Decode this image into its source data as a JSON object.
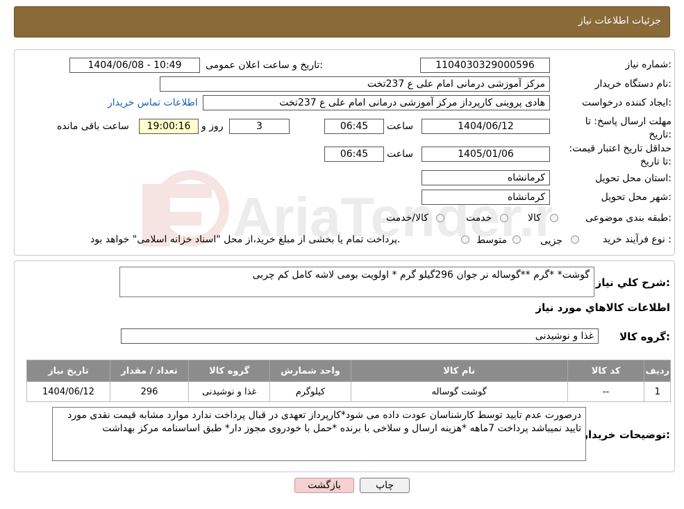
{
  "header": {
    "title": "جزئیات اطلاعات نیاز"
  },
  "watermark": {
    "brand": "AriaTender.neT"
  },
  "fields": {
    "need_number_label": "شماره نیاز:",
    "need_number": "1104030329000596",
    "announce_label": "تاریخ و ساعت اعلان عمومی:",
    "announce_value": "1404/06/08 - 10:49",
    "buyer_org_label": "نام دستگاه خریدار:",
    "buyer_org": "مرکز آموزشی درمانی امام علی ع 237تخت",
    "creator_label": "ایجاد کننده درخواست:",
    "creator": "هادی پروینی کارپرداز  مرکز آموزشی درمانی امام علی ع 237تخت",
    "contact_link": "اطلاعات تماس خریدار",
    "deadline_label": "مهلت ارسال پاسخ: تا تاریخ:",
    "deadline_date": "1404/06/12",
    "time_label": "ساعت",
    "deadline_time": "06:45",
    "days_count": "3",
    "days_label": "روز و",
    "remaining_time": "19:00:16",
    "remaining_label": "ساعت باقی مانده",
    "price_valid_label": "حداقل تاریخ اعتبار قیمت: تا تاریخ:",
    "price_valid_date": "1405/01/06",
    "price_valid_time": "06:45",
    "province_label": "استان محل تحویل:",
    "province": "کرمانشاه",
    "city_label": "شهر محل تحویل:",
    "city": "کرمانشاه",
    "category_label": "طبقه بندی موضوعی:",
    "category_options": [
      "کالا",
      "خدمت",
      "کالا/خدمت"
    ],
    "process_label": "نوع فرآیند خرید :",
    "process_options": [
      "جزیی",
      "متوسط"
    ],
    "process_note": "پرداخت تمام یا بخشی از مبلغ خرید،از محل \"اسناد خزانه اسلامی\" خواهد بود."
  },
  "summary": {
    "description_label": "شرح کلي نياز:",
    "description": "گوشت* *گرم **گوساله نر جوان   296گیلو گرم  * اولویت بومی   لاشه کامل  کم چربی",
    "goods_info_title": "اطلاعات کالاهاي مورد نياز",
    "goods_group_label": "گروه کالا:",
    "goods_group": "غذا و نوشیدنی"
  },
  "table": {
    "headers": [
      "رديف",
      "کد کالا",
      "نام کالا",
      "واحد شمارش",
      "گروه کالا",
      "تعداد / مقدار",
      "تاريخ نياز"
    ],
    "rows": [
      [
        "1",
        "--",
        "گوشت گوساله",
        "کیلوگرم",
        "غذا و نوشیدنی",
        "296",
        "1404/06/12"
      ]
    ]
  },
  "buyer_notes": {
    "label": "توضیحات خریدار:",
    "text": "درصورت عدم تایید توسط کارشناسان عودت داده می شود*کارپرداز تعهدی در قبال پرداخت ندارد موارد مشابه قیمت نقدی مورد تایید نمیباشد پرداخت 7ماهه *هزینه ارسال  و سلاخی با برنده *حمل با خودروی مجوز دار* طبق اساسنامه مرکز بهداشت"
  },
  "buttons": {
    "print": "چاپ",
    "back": "بازگشت"
  }
}
